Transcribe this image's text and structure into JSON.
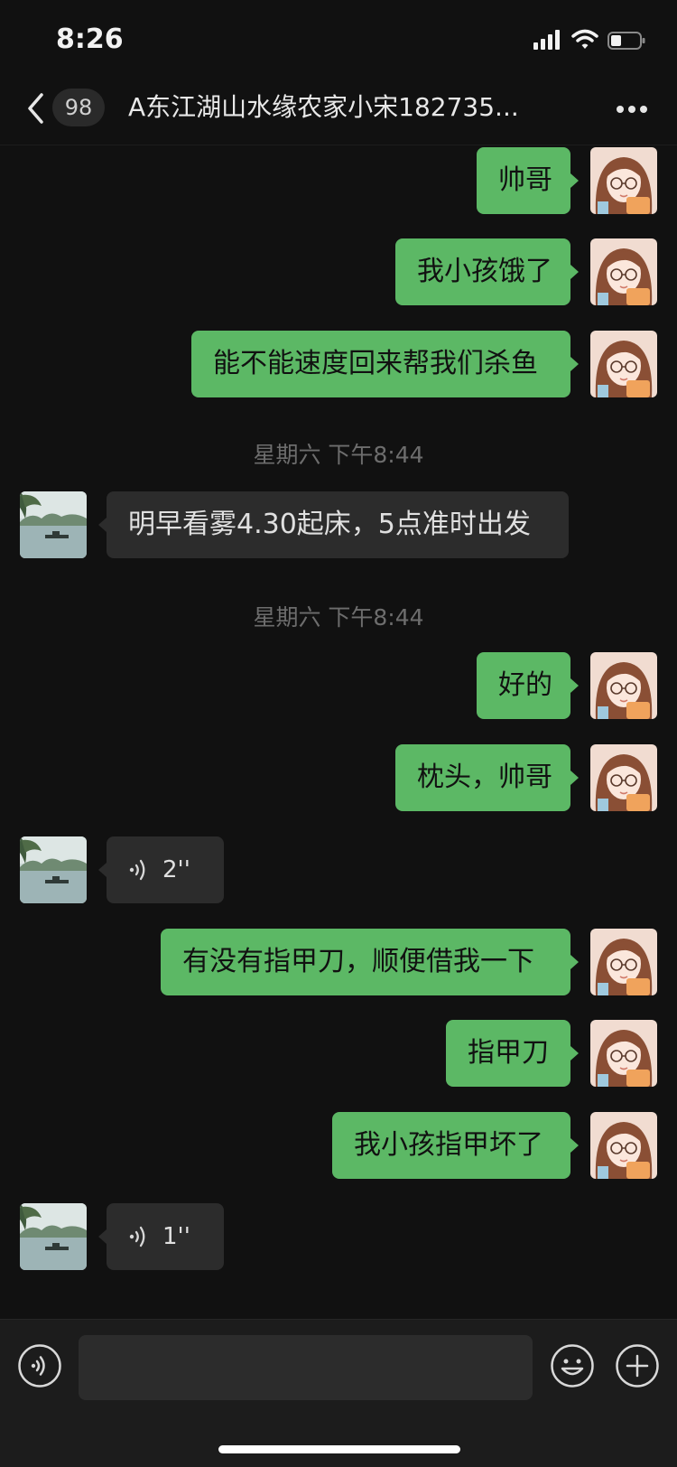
{
  "status_bar": {
    "time": "8:26"
  },
  "header": {
    "unread_count": "98",
    "title": "A东江湖山水缘农家小宋182735..."
  },
  "messages": [
    {
      "type": "text",
      "dir": "out",
      "text": "帅哥"
    },
    {
      "type": "text",
      "dir": "out",
      "text": "我小孩饿了"
    },
    {
      "type": "text",
      "dir": "out",
      "text": "能不能速度回来帮我们杀鱼"
    },
    {
      "type": "time",
      "text": "星期六 下午8:44"
    },
    {
      "type": "text",
      "dir": "in",
      "text": "明早看雾4.30起床，5点准时出发"
    },
    {
      "type": "time",
      "text": "星期六 下午8:44"
    },
    {
      "type": "text",
      "dir": "out",
      "text": "好的"
    },
    {
      "type": "text",
      "dir": "out",
      "text": "枕头，帅哥"
    },
    {
      "type": "voice",
      "dir": "in",
      "duration": "2''"
    },
    {
      "type": "text",
      "dir": "out",
      "text": "有没有指甲刀，顺便借我一下"
    },
    {
      "type": "text",
      "dir": "out",
      "text": "指甲刀"
    },
    {
      "type": "text",
      "dir": "out",
      "text": "我小孩指甲坏了"
    },
    {
      "type": "voice",
      "dir": "in",
      "duration": "1''"
    }
  ],
  "colors": {
    "background": "#111111",
    "bubble_out": "#5cb865",
    "bubble_in": "#2c2c2c",
    "input_bar": "#1c1c1c"
  },
  "icons": {
    "back": "chevron-left-icon",
    "more": "more-dots-icon",
    "voice_toggle": "voice-icon",
    "emoji": "emoji-icon",
    "plus": "plus-icon"
  }
}
